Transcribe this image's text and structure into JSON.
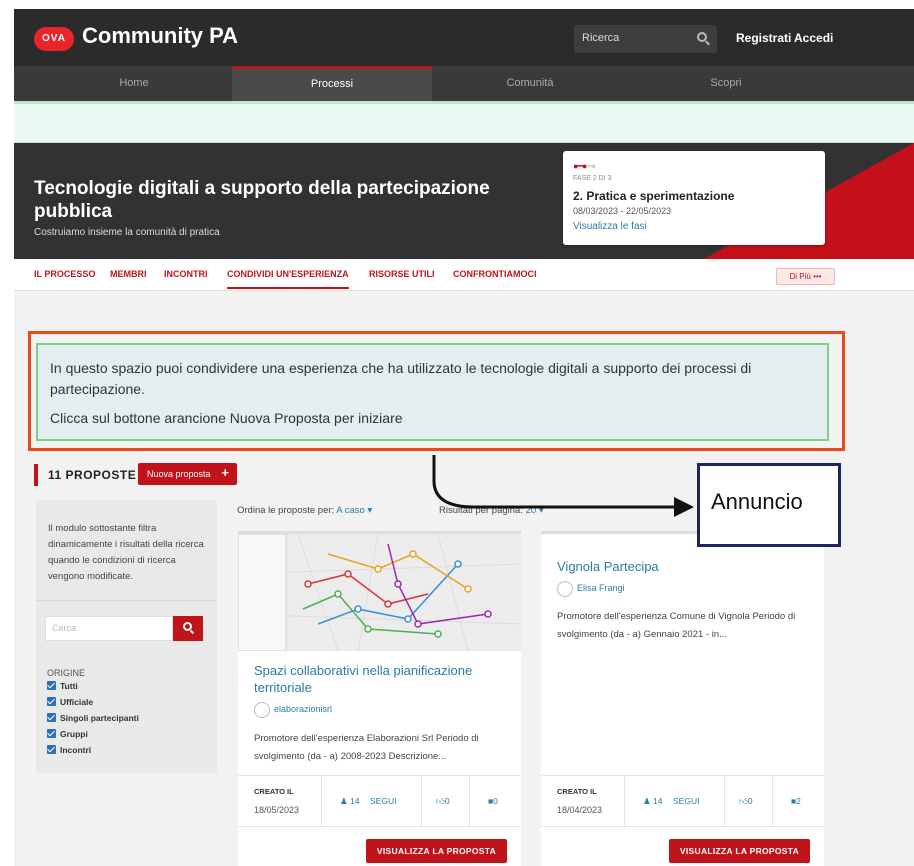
{
  "header": {
    "brand": "Community PA",
    "logo_text": "OVA",
    "search_placeholder": "Ricerca",
    "register": "Registrati",
    "login": "Accedi"
  },
  "nav": [
    "Home",
    "Processi",
    "Comunità",
    "Scopri"
  ],
  "hero": {
    "title": "Tecnologie digitali a supporto della partecipazione pubblica",
    "subtitle": "Costruiamo insieme la comunità di pratica"
  },
  "phase": {
    "label": "FASE 2 DI 3",
    "name": "2. Pratica e sperimentazione",
    "dates": "08/03/2023 - 22/05/2023",
    "link": "Visualizza le fasi",
    "current": 2,
    "total": 3
  },
  "subnav": {
    "items": [
      "IL PROCESSO",
      "MEMBRI",
      "INCONTRI",
      "CONDIVIDI UN'ESPERIENZA",
      "RISORSE UTILI",
      "CONFRONTIAMOCI"
    ],
    "more": "Di Più •••"
  },
  "announcement": {
    "line1": "In questo spazio puoi condividere una esperienza che ha utilizzato le tecnologie digitali a supporto dei processi di partecipazione.",
    "line2": "Clicca sul bottone arancione Nuova Proposta per iniziare"
  },
  "callout": "Annuncio",
  "proposals": {
    "count": "11 PROPOSTE",
    "new_button": "Nuova proposta",
    "sort_label": "Ordina le proposte per:",
    "sort_value": "A caso",
    "per_page_label": "Risultati per pagina:",
    "per_page_value": "20"
  },
  "sidebar": {
    "description": "Il modulo sottostante filtra dinamicamente i risultati della ricerca quando le condizioni di ricerca vengono modificate.",
    "search_placeholder": "Cerca",
    "origin_title": "ORIGINE",
    "options": [
      "Tutti",
      "Ufficiale",
      "Singoli partecipanti",
      "Gruppi",
      "Incontri"
    ]
  },
  "cards": [
    {
      "title": "Spazi collaborativi nella pianificazione territoriale",
      "author": "elaborazionisrl",
      "description": "Promotore dell'esperienza Elaborazioni Srl Periodo di svolgimento (da - a) 2008-2023 Descrizione...",
      "created_label": "CREATO IL",
      "created_date": "18/05/2023",
      "followers": "14",
      "follow": "SEGUI",
      "votes": "0",
      "comments": "0",
      "button": "VISUALIZZA LA PROPOSTA"
    },
    {
      "title": "Vignola Partecipa",
      "author": "Elisa Frangi",
      "description": "Promotore dell'esperienza Comune di Vignola Periodo di svolgimento (da - a) Gennaio 2021 - in...",
      "created_label": "CREATO IL",
      "created_date": "18/04/2023",
      "followers": "14",
      "follow": "SEGUI",
      "votes": "0",
      "comments": "2",
      "button": "VISUALIZZA LA PROPOSTA"
    }
  ],
  "colors": {
    "accent": "#c0141a",
    "link": "#2a7ca1",
    "announcement_border": "#ea4a1e",
    "announcement_inner": "#7ad18a",
    "callout_border": "#1e2460"
  }
}
